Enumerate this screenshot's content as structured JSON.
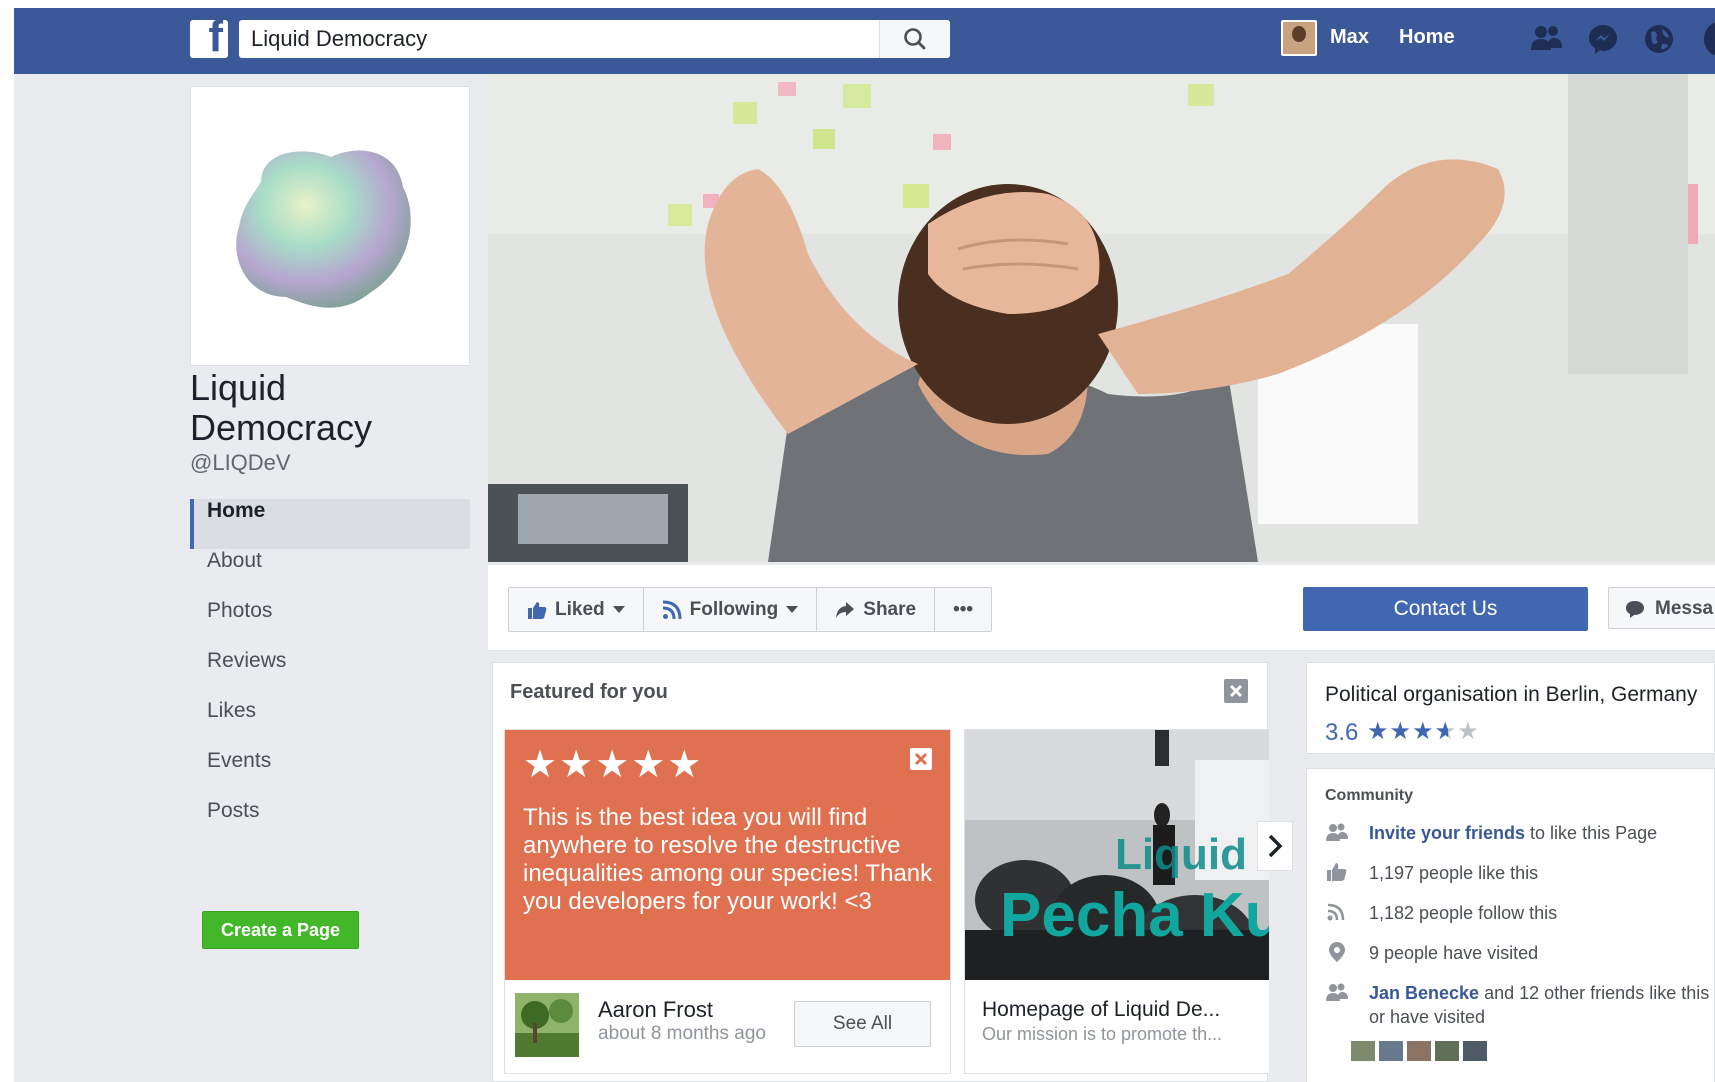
{
  "topbar": {
    "logo_letter": "f",
    "search_value": "Liquid Democracy",
    "user_name": "Max",
    "home_label": "Home"
  },
  "page": {
    "name": "Liquid Democracy",
    "handle": "@LIQDeV"
  },
  "leftnav": {
    "items": [
      "Home",
      "About",
      "Photos",
      "Reviews",
      "Likes",
      "Events",
      "Posts"
    ],
    "active": "Home",
    "create_page": "Create a Page"
  },
  "actions": {
    "liked": "Liked",
    "following": "Following",
    "share": "Share",
    "more": "•••",
    "contact": "Contact Us",
    "message": "Messa"
  },
  "featured": {
    "title": "Featured for you",
    "review": {
      "stars": "★★★★★",
      "text": "This is the best idea you will find anywhere to resolve the destructive inequalities among our species! Thank you developers for your work! <3",
      "author": "Aaron Frost",
      "time": "about 8 months ago",
      "see_all": "See All"
    },
    "homepage": {
      "overlay_line1": "Liquid",
      "overlay_line2": "Pecha Ku",
      "title": "Homepage of Liquid De...",
      "desc": "Our mission is to promote th..."
    }
  },
  "about": {
    "category": "Political organisation in Berlin, Germany",
    "rating": "3.6",
    "rating_value": 3.6,
    "rating_stars": "★★★★★"
  },
  "community": {
    "title": "Community",
    "invite_link": "Invite your friends",
    "invite_rest": " to like this Page",
    "likes": "1,197 people like this",
    "follows": "1,182 people follow this",
    "visited": "9 people have visited",
    "friend_link": "Jan Benecke",
    "friend_rest": " and 12 other friends like this or have visited"
  },
  "colors": {
    "brand": "#3b5998",
    "button_blue": "#4267b2",
    "create_green": "#42b72a",
    "review_orange": "#e07150"
  }
}
